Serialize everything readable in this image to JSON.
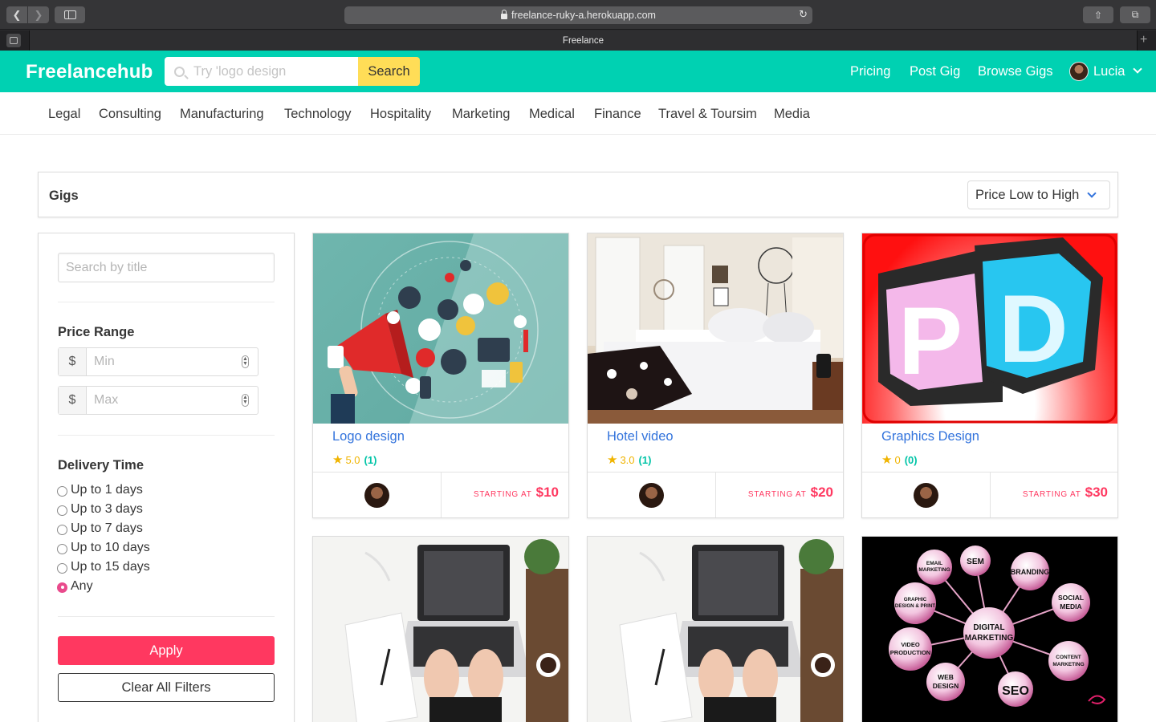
{
  "browser": {
    "url": "freelance-ruky-a.herokuapp.com",
    "tab_title": "Freelance"
  },
  "header": {
    "logo": "Freelancehub",
    "search_placeholder": "Try 'logo design",
    "search_button": "Search",
    "nav": [
      "Pricing",
      "Post Gig",
      "Browse Gigs"
    ],
    "user_name": "Lucia"
  },
  "categories": [
    "Legal",
    "Consulting",
    "Manufacturing",
    "Technology",
    "Hospitality",
    "Marketing",
    "Medical",
    "Finance",
    "Travel & Toursim",
    "Media"
  ],
  "gigs_header": {
    "title": "Gigs",
    "sort_selected": "Price Low to High"
  },
  "filters": {
    "title_placeholder": "Search by title",
    "price_range_title": "Price Range",
    "currency_symbol": "$",
    "min_placeholder": "Min",
    "max_placeholder": "Max",
    "delivery_title": "Delivery Time",
    "delivery_options": [
      "Up to 1 days",
      "Up to 3 days",
      "Up to 7 days",
      "Up to 10 days",
      "Up to 15 days",
      "Any"
    ],
    "delivery_selected": "Any",
    "apply_label": "Apply",
    "clear_label": "Clear All Filters"
  },
  "gigs": [
    {
      "title": "Logo design",
      "rating": "5.0",
      "reviews": "(1)",
      "starting_label": "STARTING AT",
      "price": "$10"
    },
    {
      "title": "Hotel video",
      "rating": "3.0",
      "reviews": "(1)",
      "starting_label": "STARTING AT",
      "price": "$20"
    },
    {
      "title": "Graphics Design",
      "rating": "0",
      "reviews": "(0)",
      "starting_label": "STARTING AT",
      "price": "$30"
    }
  ],
  "image_text": {
    "pd_letters": "PD",
    "digital_marketing": {
      "center": "DIGITAL MARKETING",
      "nodes": [
        "EMAIL MARKETING",
        "SEM",
        "BRANDING",
        "GRAPHIC DESIGN & PRINT",
        "SOCIAL MEDIA",
        "VIDEO PRODUCTION",
        "CONTENT MARKETING",
        "WEB DESIGN",
        "SEO"
      ]
    }
  },
  "colors": {
    "brand": "#00d1b2",
    "accent_yellow": "#ffdd57",
    "danger": "#ff3860",
    "link": "#3273dc"
  }
}
